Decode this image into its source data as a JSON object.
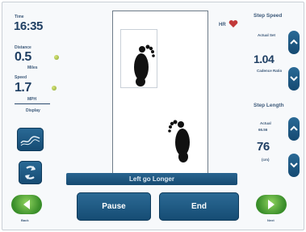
{
  "left": {
    "time_label": "Time",
    "time_value": "16:35",
    "distance_label": "Distance",
    "distance_value": "0.5",
    "distance_unit": "Miles",
    "speed_label": "Speed",
    "speed_value": "1.7",
    "speed_unit": "MPH",
    "display_label": "Display"
  },
  "right": {
    "hr_label": "HR",
    "step_speed_title": "Step Speed",
    "step_speed_sub": "Actual Set",
    "step_speed_value": "1.04",
    "step_speed_unit": "Cadence Ratio",
    "step_length_title": "Step Length",
    "step_length_sub": "Actual",
    "step_length_sub2": "66.56",
    "step_length_value": "76",
    "step_length_unit": "(cm)"
  },
  "center": {
    "status_message": "Left go Longer"
  },
  "bottom": {
    "pause_label": "Pause",
    "end_label": "End",
    "back_label": "Back",
    "next_label": "Next"
  },
  "colors": {
    "button_blue": "#1c5a86",
    "green_button": "#4aa23a",
    "accent_text": "#2a4a6e"
  },
  "icons": [
    "graph-icon",
    "swap-feet-icon",
    "heart-icon",
    "left-arrow-icon",
    "right-arrow-icon",
    "chevron-up-icon",
    "chevron-down-icon",
    "left-footprint-icon",
    "right-footprint-icon"
  ]
}
